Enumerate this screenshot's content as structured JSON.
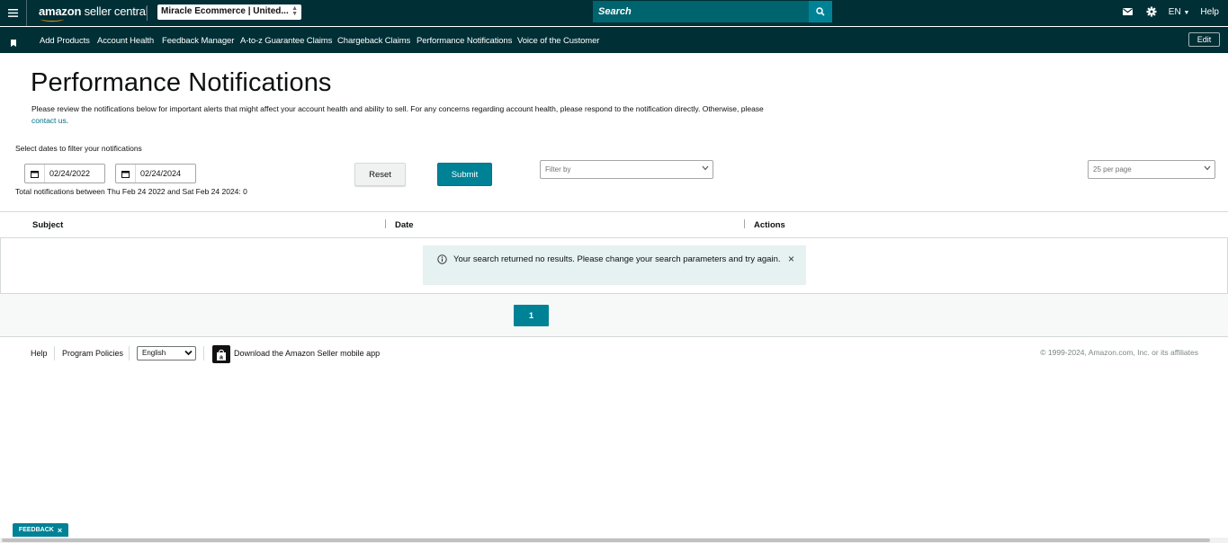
{
  "header": {
    "logo_brand": "amazon",
    "logo_product": "seller central",
    "store_selector": "Miracle Ecommerce | United...",
    "search_placeholder": "Search",
    "language": "EN",
    "help": "Help"
  },
  "nav": {
    "items": [
      "Add Products",
      "Account Health",
      "Feedback Manager",
      "A-to-z Guarantee Claims",
      "Chargeback Claims",
      "Performance Notifications",
      "Voice of the Customer"
    ],
    "edit": "Edit"
  },
  "main": {
    "title": "Performance Notifications",
    "intro_text": "Please review the notifications below for important alerts that might affect your account health and ability to sell. For any concerns regarding account health, please respond to the notification directly. Otherwise, please",
    "intro_link": "contact us",
    "intro_end": ".",
    "filter_label": "Select dates to filter your notifications",
    "date_from": "02/24/2022",
    "date_to": "02/24/2024",
    "total_text": "Total notifications between Thu Feb 24 2022 and Sat Feb 24 2024: 0",
    "reset": "Reset",
    "submit": "Submit",
    "filter_by_placeholder": "Filter by",
    "per_page": "25 per page"
  },
  "table": {
    "columns": [
      "Subject",
      "Date",
      "Actions"
    ],
    "empty_message": "Your search returned no results. Please change your search parameters and try again.",
    "close": "×"
  },
  "pagination": {
    "current_page": "1"
  },
  "footer": {
    "help": "Help",
    "program_policies": "Program Policies",
    "language": "English",
    "download_app": "Download the Amazon Seller mobile app",
    "copyright": "© 1999-2024, Amazon.com, Inc. or its affiliates"
  },
  "feedback": {
    "label": "FEEDBACK",
    "close": "×"
  },
  "colors": {
    "header_bg": "#002f36",
    "accent": "#008296",
    "search_bg": "#00646f",
    "alert_bg": "#e6f1f2",
    "link": "#007185"
  }
}
